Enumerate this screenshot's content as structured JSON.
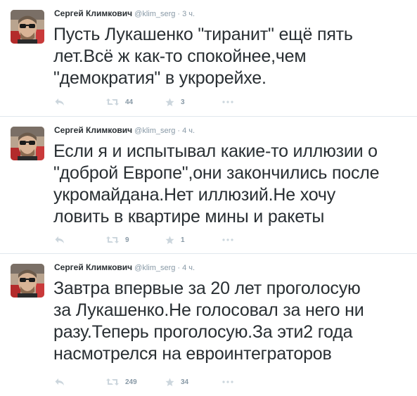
{
  "colors": {
    "name": "#292f33",
    "meta": "#8899a6",
    "icon": "#ccd6dd",
    "divider": "#e1e8ed"
  },
  "icons": {
    "reply": "reply-icon",
    "retweet": "retweet-icon",
    "favorite": "star-icon",
    "more": "more-dots-icon"
  },
  "tweets": [
    {
      "author": "Сергей Климкович",
      "username": "@klim_serg",
      "separator": "·",
      "time": "3 ч.",
      "lines": [
        "Пусть Лукашенко \"тиранит\" ещё пять",
        "лет.Всё ж как-то спокойнее,чем",
        "\"демократия\" в укрорейхе."
      ],
      "retweets": "44",
      "favorites": "3"
    },
    {
      "author": "Сергей Климкович",
      "username": "@klim_serg",
      "separator": "·",
      "time": "4 ч.",
      "lines": [
        "Если я и испытывал какие-то иллюзии о",
        "\"доброй Европе\",они закончились после",
        "укромайдана.Нет иллюзий.Не хочу",
        "ловить в квартире мины и ракеты"
      ],
      "retweets": "9",
      "favorites": "1"
    },
    {
      "author": "Сергей Климкович",
      "username": "@klim_serg",
      "separator": "·",
      "time": "4 ч.",
      "lines": [
        "Завтра впервые за 20 лет проголосую",
        "за Лукашенко.Не голосовал за него ни",
        "разу.Теперь проголосую.За эти2 года",
        "насмотрелся на евроинтеграторов"
      ],
      "retweets": "249",
      "favorites": "34"
    }
  ]
}
